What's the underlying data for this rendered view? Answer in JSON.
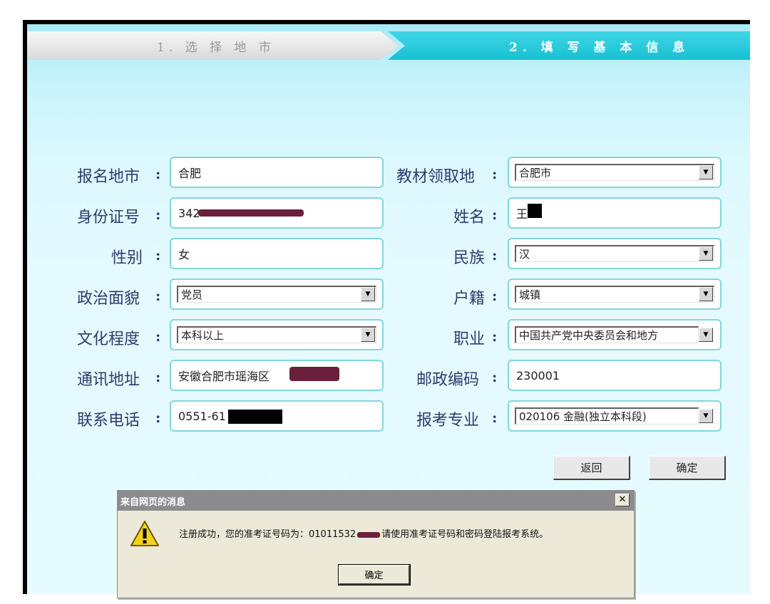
{
  "steps": {
    "step1": "1. 选 择 地 市",
    "step2": "2. 填 写 基 本 信 息"
  },
  "form": {
    "city": {
      "label": "报名地市",
      "value": "合肥"
    },
    "material_location": {
      "label": "教材领取地",
      "value": "合肥市"
    },
    "id_number": {
      "label": "身份证号",
      "value": "342"
    },
    "name": {
      "label": "姓名",
      "value": "王"
    },
    "gender": {
      "label": "性别",
      "value": "女"
    },
    "ethnicity": {
      "label": "民族",
      "value": "汉"
    },
    "political_status": {
      "label": "政治面貌",
      "value": "党员"
    },
    "household": {
      "label": "户籍",
      "value": "城镇"
    },
    "education": {
      "label": "文化程度",
      "value": "本科以上"
    },
    "occupation": {
      "label": "职业",
      "value": "中国共产党中央委员会和地方"
    },
    "address": {
      "label": "通讯地址",
      "value": "安徽合肥市瑶海区"
    },
    "postcode": {
      "label": "邮政编码",
      "value": "230001"
    },
    "phone": {
      "label": "联系电话",
      "value": "0551-61"
    },
    "major": {
      "label": "报考专业",
      "value": "020106 金融(独立本科段)"
    },
    "colon": ":"
  },
  "buttons": {
    "back": "返回",
    "confirm": "确定"
  },
  "dialog": {
    "title": "来自网页的消息",
    "close": "✕",
    "message_prefix": "注册成功，您的准考证号码为：01011532",
    "message_suffix": "请使用准考证号码和密码登陆报考系统。",
    "ok": "确定"
  },
  "icons": {
    "warning": "warning-icon",
    "dropdown": "chevron-down-icon"
  },
  "colors": {
    "step_active": "#18c0d3",
    "label_text": "#2f3b6e",
    "field_border": "#7fd8dd"
  }
}
